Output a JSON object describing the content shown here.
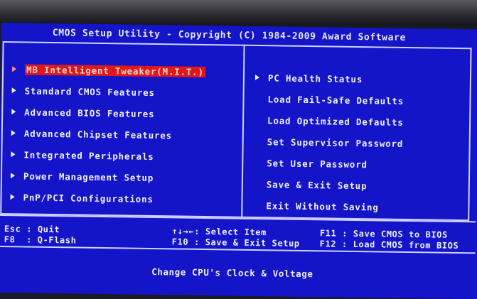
{
  "title": "CMOS Setup Utility - Copyright (C) 1984-2009 Award Software",
  "left_menu": [
    {
      "label": "MB Intelligent Tweaker(M.I.T.)",
      "arrow": true,
      "selected": true
    },
    {
      "label": "Standard CMOS Features",
      "arrow": true,
      "selected": false
    },
    {
      "label": "Advanced BIOS Features",
      "arrow": true,
      "selected": false
    },
    {
      "label": "Advanced Chipset Features",
      "arrow": true,
      "selected": false
    },
    {
      "label": "Integrated Peripherals",
      "arrow": true,
      "selected": false
    },
    {
      "label": "Power Management Setup",
      "arrow": true,
      "selected": false
    },
    {
      "label": "PnP/PCI Configurations",
      "arrow": true,
      "selected": false
    }
  ],
  "right_menu": [
    {
      "label": "PC Health Status",
      "arrow": true
    },
    {
      "label": "Load Fail-Safe Defaults",
      "arrow": false
    },
    {
      "label": "Load Optimized Defaults",
      "arrow": false
    },
    {
      "label": "Set Supervisor Password",
      "arrow": false
    },
    {
      "label": "Set User Password",
      "arrow": false
    },
    {
      "label": "Save & Exit Setup",
      "arrow": false
    },
    {
      "label": "Exit Without Saving",
      "arrow": false
    }
  ],
  "keys": {
    "esc": "Esc : Quit",
    "f8": "F8  : Q-Flash",
    "select": "↑↓→←: Select Item",
    "f10": "F10 : Save & Exit Setup",
    "f11": "F11 : Save CMOS to BIOS",
    "f12": "F12 : Load CMOS from BIOS"
  },
  "status": "Change CPU's Clock & Voltage",
  "colors": {
    "background": "#1414c8",
    "text": "#f0f0ff",
    "highlight": "#e01818",
    "border": "#cfd2ff"
  }
}
